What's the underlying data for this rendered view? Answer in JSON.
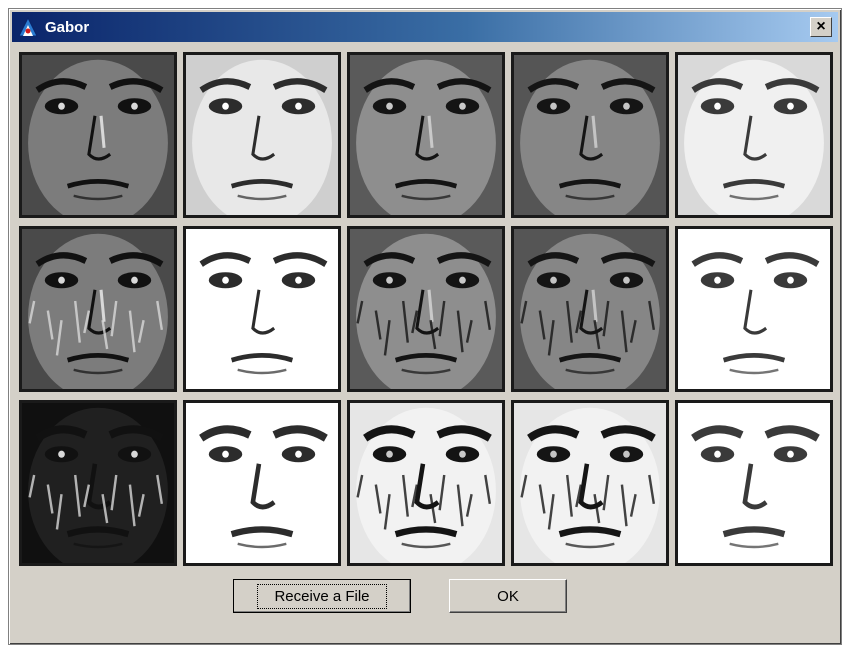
{
  "window": {
    "title": "Gabor",
    "close_glyph": "×"
  },
  "tile_columns": [
    {
      "bg": "#4a4a4a",
      "skin": "#7c7c7c",
      "feat": "#111111",
      "hi": "#d8d8d8"
    },
    {
      "bg": "#cfcfcf",
      "skin": "#e8e8e8",
      "feat": "#2c2c2c",
      "hi": "#ffffff"
    },
    {
      "bg": "#5a5a5a",
      "skin": "#8e8e8e",
      "feat": "#141414",
      "hi": "#c9c9c9"
    },
    {
      "bg": "#555555",
      "skin": "#868686",
      "feat": "#151515",
      "hi": "#c4c4c4"
    },
    {
      "bg": "#d9d9d9",
      "skin": "#f0f0f0",
      "feat": "#3a3a3a",
      "hi": "#ffffff"
    }
  ],
  "buttons": {
    "receive_label": "Receive a File",
    "ok_label": "OK"
  }
}
